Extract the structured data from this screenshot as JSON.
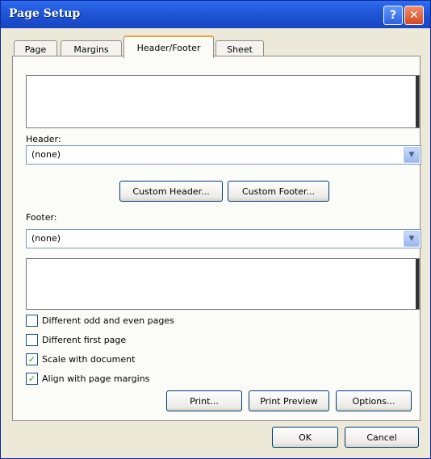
{
  "window": {
    "title": "Page Setup"
  },
  "titlebar": {
    "help_glyph": "?",
    "close_glyph": "✕"
  },
  "tabs": [
    {
      "label": "Page"
    },
    {
      "label": "Margins"
    },
    {
      "label": "Header/Footer",
      "active": true
    },
    {
      "label": "Sheet"
    }
  ],
  "header": {
    "label": "Header:",
    "value": "(none)"
  },
  "footer": {
    "label": "Footer:",
    "value": "(none)"
  },
  "buttons": {
    "custom_header": "Custom Header...",
    "custom_footer": "Custom Footer...",
    "print": "Print...",
    "print_preview": "Print Preview",
    "options": "Options...",
    "ok": "OK",
    "cancel": "Cancel"
  },
  "checkboxes": [
    {
      "label": "Different odd and even pages",
      "checked": false
    },
    {
      "label": "Different first page",
      "checked": false
    },
    {
      "label": "Scale with document",
      "checked": true
    },
    {
      "label": "Align with page margins",
      "checked": true
    }
  ],
  "icons": {
    "dropdown": "chevron-down-icon",
    "check": "checkmark-icon"
  }
}
